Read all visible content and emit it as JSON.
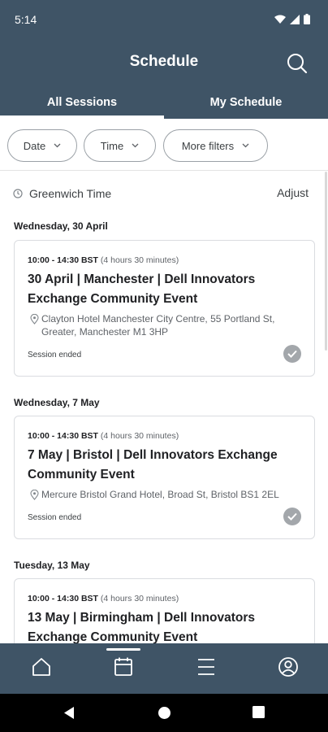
{
  "status_bar": {
    "time": "5:14"
  },
  "header": {
    "title": "Schedule"
  },
  "tabs": [
    {
      "label": "All Sessions",
      "active": true
    },
    {
      "label": "My Schedule",
      "active": false
    }
  ],
  "filters": [
    {
      "label": "Date"
    },
    {
      "label": "Time"
    },
    {
      "label": "More filters"
    }
  ],
  "timezone": {
    "label": "Greenwich Time",
    "adjust_label": "Adjust"
  },
  "days": [
    {
      "header": "Wednesday, 30 April",
      "session": {
        "time": "10:00 - 14:30 BST",
        "duration": "(4 hours 30 minutes)",
        "title": "30 April | Manchester | Dell Innovators Exchange Community Event",
        "location": "Clayton Hotel Manchester City Centre, 55 Portland St, Greater, Manchester M1 3HP",
        "status": "Session ended"
      }
    },
    {
      "header": "Wednesday, 7 May",
      "session": {
        "time": "10:00 - 14:30 BST",
        "duration": "(4 hours 30 minutes)",
        "title": "7 May | Bristol | Dell Innovators Exchange Community Event",
        "location": "Mercure Bristol Grand Hotel, Broad St, Bristol BS1 2EL",
        "status": "Session ended"
      }
    },
    {
      "header": "Tuesday, 13 May",
      "session": {
        "time": "10:00 - 14:30 BST",
        "duration": "(4 hours 30 minutes)",
        "title": "13 May | Birmingham | Dell Innovators Exchange Community Event"
      }
    }
  ],
  "bottom_nav": [
    {
      "icon": "home-icon"
    },
    {
      "icon": "calendar-icon",
      "active": true
    },
    {
      "icon": "menu-icon"
    },
    {
      "icon": "profile-icon"
    }
  ],
  "colors": {
    "header_bg": "#3f5466",
    "check_bg": "#a3a7ab"
  }
}
